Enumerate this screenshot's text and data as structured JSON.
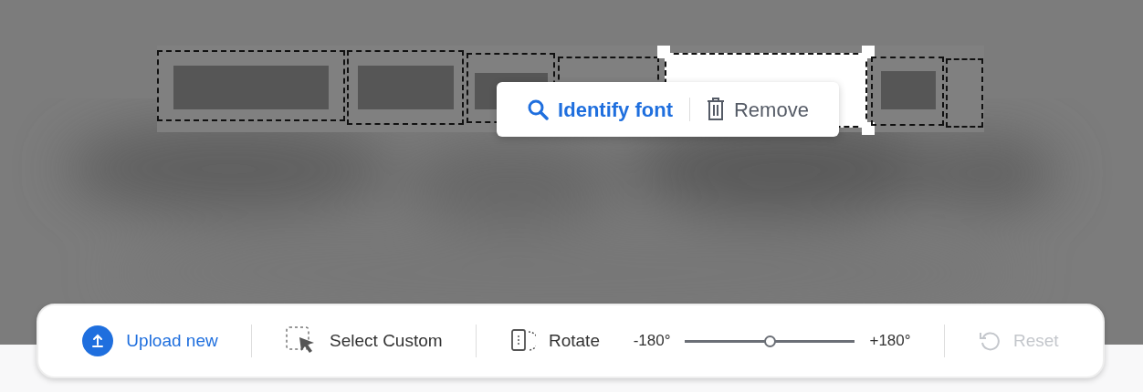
{
  "word_boxes": [
    {
      "selected": false
    },
    {
      "selected": false
    },
    {
      "selected": false
    },
    {
      "selected": false
    },
    {
      "selected": true
    },
    {
      "selected": false
    },
    {
      "selected": false
    }
  ],
  "popup": {
    "actions": [
      {
        "kind": "identify",
        "label": "Identify font"
      },
      {
        "kind": "remove",
        "label": "Remove"
      }
    ]
  },
  "toolbar": {
    "items": [
      {
        "kind": "upload",
        "label": "Upload new",
        "disabled": false
      },
      {
        "kind": "select",
        "label": "Select Custom",
        "disabled": false
      },
      {
        "kind": "rotate",
        "label": "Rotate",
        "min_label": "-180°",
        "max_label": "+180°",
        "level": 0.5,
        "disabled": false
      },
      {
        "kind": "reset",
        "label": "Reset",
        "disabled": true
      }
    ]
  }
}
